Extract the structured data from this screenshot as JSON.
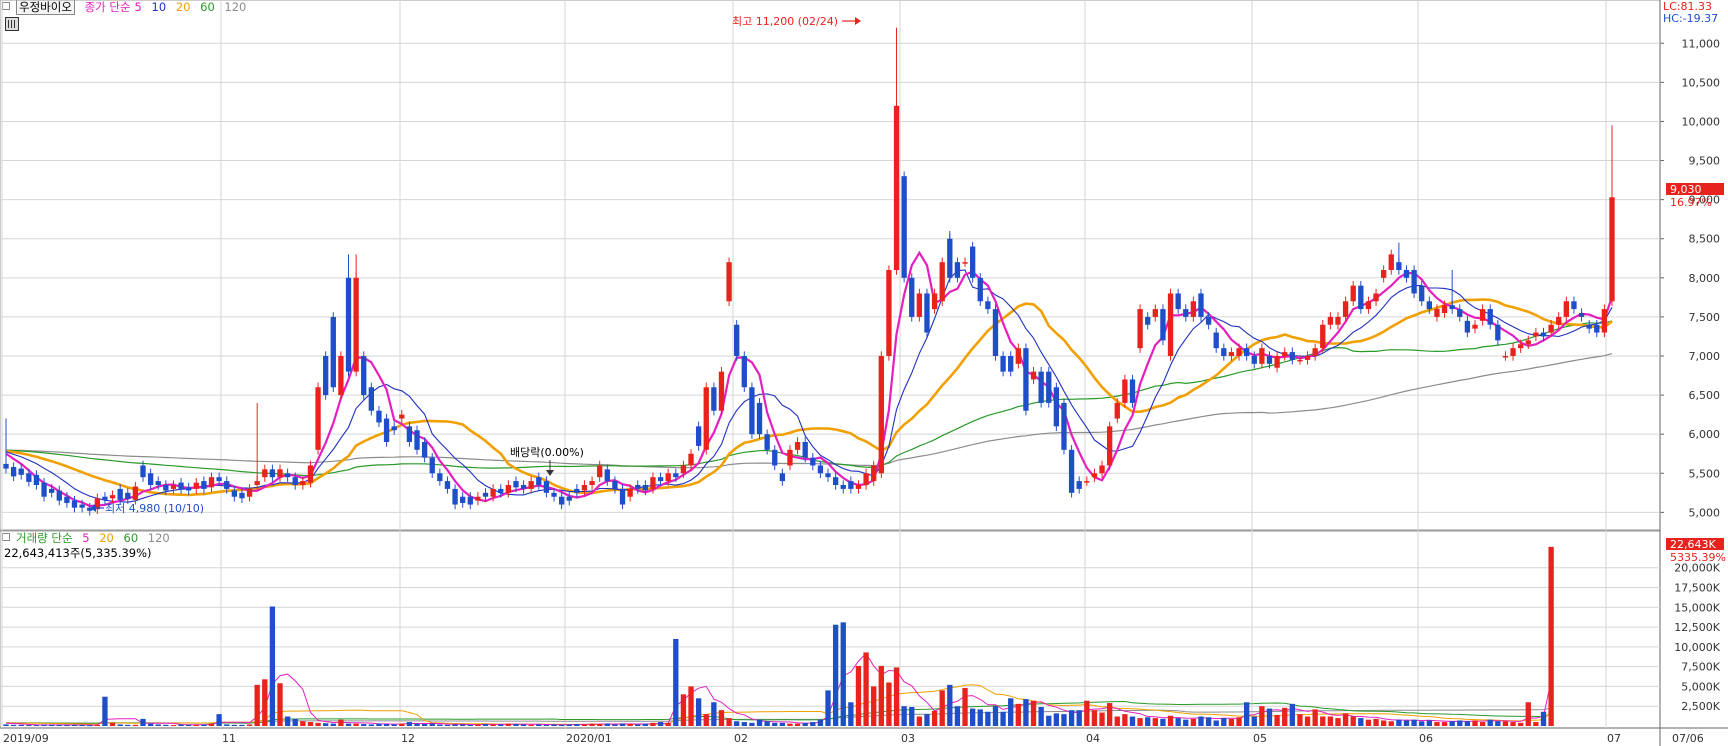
{
  "price_panel": {
    "stock_name": "우정바이오",
    "ma_legend": {
      "prefix": "종가 단순",
      "periods": [
        "5",
        "10",
        "20",
        "60",
        "120"
      ]
    },
    "high_annotation": "최고 11,200 (02/24)",
    "low_annotation": "최저 4,980 (10/10)",
    "dividend_annotation": "배당락(0.00%)",
    "lc_label": "LC:81.33",
    "hc_label": "HC:-19.37",
    "last_price_label": "9,030",
    "last_change_label": "16.97%"
  },
  "volume_panel": {
    "legend_prefix": "거래량 단순",
    "periods": [
      "5",
      "20",
      "60",
      "120"
    ],
    "summary": "22,643,413주(5,335.39%)",
    "last_volume_label": "22,643K",
    "last_volume_pct": "5335.39%"
  },
  "colors": {
    "up": "#e8231e",
    "down": "#1f4fc8",
    "ma5": "#e51fbf",
    "ma10": "#2030c0",
    "ma20": "#f0a000",
    "ma60": "#2a9a2a",
    "ma120": "#8c8c8c",
    "grid": "#d6d6d6"
  },
  "chart_data": {
    "type": "candlestick",
    "y_price_ticks": [
      "5,000",
      "5,500",
      "6,000",
      "6,500",
      "7,000",
      "7,500",
      "8,000",
      "8,500",
      "9,000",
      "9,500",
      "10,000",
      "10,500",
      "11,000"
    ],
    "y_price_range": [
      4800,
      11400
    ],
    "y_volume_ticks": [
      "2,500K",
      "5,000K",
      "7,500K",
      "10,000K",
      "12,500K",
      "15,000K",
      "17,500K",
      "20,000K"
    ],
    "y_volume_range": [
      0,
      23000
    ],
    "x_labels": [
      "2019/09",
      "11",
      "12",
      "2020/01",
      "02",
      "03",
      "04",
      "05",
      "06",
      "07"
    ],
    "last_date_label": "07/06",
    "candles": [
      [
        5620,
        5560
      ],
      [
        5580,
        5460
      ],
      [
        5560,
        5480
      ],
      [
        5500,
        5390
      ],
      [
        5480,
        5350
      ],
      [
        5380,
        5200
      ],
      [
        5300,
        5250
      ],
      [
        5280,
        5150
      ],
      [
        5200,
        5120
      ],
      [
        5150,
        5060
      ],
      [
        5100,
        5060
      ],
      [
        5060,
        5020
      ],
      [
        5040,
        5180
      ],
      [
        5200,
        5160
      ],
      [
        5180,
        5220
      ],
      [
        5300,
        5160
      ],
      [
        5250,
        5170
      ],
      [
        5160,
        5330
      ],
      [
        5600,
        5450
      ],
      [
        5500,
        5350
      ],
      [
        5400,
        5350
      ],
      [
        5350,
        5280
      ],
      [
        5300,
        5350
      ],
      [
        5380,
        5300
      ],
      [
        5320,
        5280
      ],
      [
        5300,
        5380
      ],
      [
        5400,
        5300
      ],
      [
        5320,
        5450
      ],
      [
        5450,
        5400
      ],
      [
        5400,
        5300
      ],
      [
        5280,
        5200
      ],
      [
        5250,
        5180
      ],
      [
        5200,
        5300
      ],
      [
        5350,
        5400
      ],
      [
        5450,
        5550
      ],
      [
        5550,
        5450
      ],
      [
        5450,
        5550
      ],
      [
        5500,
        5450
      ],
      [
        5450,
        5350
      ],
      [
        5350,
        5400
      ],
      [
        5380,
        5600
      ],
      [
        5800,
        6600
      ],
      [
        7000,
        6500
      ],
      [
        7500,
        6600
      ],
      [
        6500,
        7000
      ],
      [
        8000,
        6800
      ],
      [
        6800,
        8000
      ],
      [
        7000,
        6500
      ],
      [
        6600,
        6300
      ],
      [
        6300,
        6150
      ],
      [
        6200,
        5900
      ],
      [
        6100,
        6050
      ],
      [
        6200,
        6250
      ],
      [
        6100,
        5900
      ],
      [
        6050,
        5800
      ],
      [
        5900,
        5700
      ],
      [
        5700,
        5500
      ],
      [
        5500,
        5400
      ],
      [
        5400,
        5300
      ],
      [
        5300,
        5100
      ],
      [
        5200,
        5120
      ],
      [
        5200,
        5100
      ],
      [
        5150,
        5200
      ],
      [
        5250,
        5200
      ],
      [
        5200,
        5300
      ],
      [
        5300,
        5250
      ],
      [
        5250,
        5350
      ],
      [
        5400,
        5320
      ],
      [
        5350,
        5300
      ],
      [
        5300,
        5400
      ],
      [
        5450,
        5350
      ],
      [
        5400,
        5250
      ],
      [
        5250,
        5200
      ],
      [
        5200,
        5100
      ],
      [
        5200,
        5150
      ],
      [
        5300,
        5250
      ],
      [
        5280,
        5350
      ],
      [
        5350,
        5400
      ],
      [
        5450,
        5600
      ],
      [
        5550,
        5400
      ],
      [
        5400,
        5300
      ],
      [
        5300,
        5100
      ],
      [
        5200,
        5300
      ],
      [
        5350,
        5300
      ],
      [
        5350,
        5280
      ],
      [
        5300,
        5450
      ],
      [
        5450,
        5400
      ],
      [
        5400,
        5500
      ],
      [
        5500,
        5450
      ],
      [
        5500,
        5600
      ],
      [
        5600,
        5750
      ],
      [
        6100,
        5850
      ],
      [
        5800,
        6600
      ],
      [
        6600,
        6300
      ],
      [
        6300,
        6800
      ],
      [
        7700,
        8200
      ],
      [
        7400,
        7000
      ],
      [
        7000,
        6600
      ],
      [
        6600,
        6000
      ],
      [
        6400,
        6000
      ],
      [
        6000,
        5800
      ],
      [
        5800,
        5600
      ],
      [
        5500,
        5400
      ],
      [
        5600,
        5800
      ],
      [
        5800,
        5900
      ],
      [
        5900,
        5700
      ],
      [
        5700,
        5600
      ],
      [
        5600,
        5500
      ],
      [
        5500,
        5450
      ],
      [
        5450,
        5350
      ],
      [
        5350,
        5300
      ],
      [
        5400,
        5300
      ],
      [
        5300,
        5350
      ],
      [
        5350,
        5500
      ],
      [
        5400,
        5600
      ],
      [
        5500,
        7000
      ],
      [
        7000,
        8100
      ],
      [
        8100,
        10200
      ],
      [
        9300,
        8000
      ],
      [
        8000,
        7500
      ],
      [
        7500,
        7800
      ],
      [
        7800,
        7300
      ],
      [
        7600,
        7800
      ],
      [
        7700,
        8200
      ],
      [
        8500,
        8000
      ],
      [
        8200,
        8000
      ],
      [
        8200,
        8200
      ],
      [
        8400,
        8000
      ],
      [
        8000,
        7700
      ],
      [
        7700,
        7600
      ],
      [
        7600,
        7000
      ],
      [
        7000,
        6800
      ],
      [
        7000,
        6800
      ],
      [
        6900,
        7100
      ],
      [
        7100,
        6300
      ],
      [
        6700,
        6800
      ],
      [
        6800,
        6400
      ],
      [
        6800,
        6400
      ],
      [
        6600,
        6100
      ],
      [
        6400,
        5800
      ],
      [
        5800,
        5250
      ],
      [
        5400,
        5300
      ],
      [
        5400,
        5400
      ],
      [
        5450,
        5500
      ],
      [
        5500,
        5600
      ],
      [
        5600,
        6100
      ],
      [
        6200,
        6400
      ],
      [
        6400,
        6700
      ],
      [
        6700,
        6400
      ],
      [
        7100,
        7600
      ],
      [
        7500,
        7400
      ],
      [
        7500,
        7600
      ],
      [
        7600,
        7200
      ],
      [
        7000,
        7800
      ],
      [
        7800,
        7600
      ],
      [
        7600,
        7500
      ],
      [
        7500,
        7700
      ],
      [
        7800,
        7500
      ],
      [
        7500,
        7400
      ],
      [
        7300,
        7100
      ],
      [
        7100,
        7000
      ],
      [
        7000,
        7050
      ],
      [
        7000,
        7100
      ],
      [
        7100,
        7000
      ],
      [
        7000,
        6900
      ],
      [
        6900,
        7100
      ],
      [
        7000,
        6900
      ],
      [
        6850,
        7000
      ],
      [
        7000,
        7050
      ],
      [
        7050,
        6950
      ],
      [
        6950,
        6950
      ],
      [
        6950,
        7000
      ],
      [
        7000,
        7100
      ],
      [
        7100,
        7400
      ],
      [
        7400,
        7500
      ],
      [
        7400,
        7500
      ],
      [
        7500,
        7700
      ],
      [
        7700,
        7900
      ],
      [
        7900,
        7600
      ],
      [
        7600,
        7700
      ],
      [
        7700,
        7800
      ],
      [
        8000,
        8100
      ],
      [
        8100,
        8300
      ],
      [
        8200,
        8100
      ],
      [
        8100,
        8000
      ],
      [
        8100,
        7800
      ],
      [
        7900,
        7700
      ],
      [
        7700,
        7600
      ],
      [
        7500,
        7600
      ],
      [
        7550,
        7650
      ],
      [
        7650,
        7600
      ],
      [
        7600,
        7500
      ],
      [
        7450,
        7300
      ],
      [
        7350,
        7400
      ],
      [
        7450,
        7600
      ],
      [
        7600,
        7400
      ],
      [
        7400,
        7200
      ],
      [
        7000,
        7000
      ],
      [
        7000,
        7100
      ],
      [
        7100,
        7150
      ],
      [
        7150,
        7200
      ],
      [
        7250,
        7300
      ],
      [
        7300,
        7250
      ],
      [
        7300,
        7400
      ],
      [
        7400,
        7500
      ],
      [
        7500,
        7700
      ],
      [
        7700,
        7600
      ],
      [
        7550,
        7500
      ],
      [
        7400,
        7350
      ],
      [
        7400,
        7300
      ],
      [
        7300,
        7600
      ],
      [
        7700,
        9030
      ]
    ],
    "wick_highs": [
      6200,
      6400,
      8300,
      8300,
      11200,
      8600,
      8100,
      8450,
      8300,
      9950
    ],
    "volumes": [
      200,
      150,
      150,
      120,
      120,
      150,
      150,
      130,
      120,
      130,
      120,
      110,
      120,
      3700,
      400,
      200,
      150,
      150,
      900,
      300,
      200,
      150,
      120,
      200,
      150,
      150,
      200,
      300,
      1500,
      200,
      150,
      150,
      200,
      5200,
      5900,
      15100,
      5400,
      1200,
      900,
      600,
      500,
      400,
      350,
      300,
      800,
      300,
      300,
      250,
      200,
      300,
      250,
      200,
      300,
      500,
      300,
      250,
      300,
      200,
      150,
      200,
      200,
      150,
      200,
      250,
      200,
      200,
      300,
      250,
      200,
      150,
      200,
      150,
      200,
      150,
      200,
      250,
      200,
      300,
      250,
      300,
      200,
      300,
      250,
      200,
      300,
      400,
      500,
      400,
      11000,
      4000,
      5000,
      3500,
      1500,
      3000,
      2000,
      1000,
      600,
      500,
      400,
      800,
      600,
      400,
      400,
      300,
      300,
      400,
      500,
      800,
      4500,
      12800,
      13100,
      3000,
      7600,
      9300,
      5000,
      7600,
      5500,
      7400,
      2500,
      2400,
      1200,
      1500,
      1900,
      4500,
      5200,
      2500,
      4800,
      2200,
      2100,
      1800,
      2500,
      1800,
      3500,
      2800,
      3400,
      3200,
      2400,
      1300,
      1600,
      1500,
      2000,
      2000,
      3200,
      2000,
      1700,
      2900,
      1200,
      1500,
      1200,
      1000,
      1100,
      1000,
      900,
      1300,
      1000,
      800,
      900,
      1200,
      1100,
      700,
      1000,
      900,
      1100,
      3000,
      1200,
      2500,
      2200,
      1400,
      2300,
      2800,
      1500,
      1200,
      2100,
      1200,
      1200,
      1000,
      1600,
      1200,
      1000,
      800,
      900,
      700,
      600,
      800,
      700,
      800,
      600,
      700,
      500,
      500,
      600,
      700,
      600,
      700,
      500,
      800,
      600,
      600,
      500,
      400,
      3000,
      500,
      1800,
      22643
    ]
  }
}
